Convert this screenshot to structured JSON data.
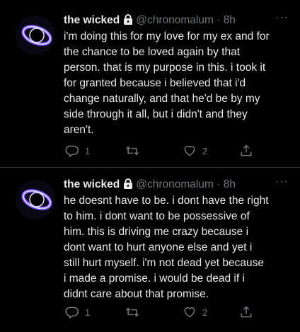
{
  "tweets": [
    {
      "display_name": "the wicked",
      "handle": "@chronomalum",
      "separator": "·",
      "time": "8h",
      "more": "···",
      "text": "i'm doing this for my love for my ex and for\nthe chance to be loved again by that\nperson. that is my purpose in this. i took it\nfor granted because i believed that i'd\nchange naturally, and that he'd be by my\nside through it all, but i didn't and they\naren't.",
      "reply_count": "1",
      "retweet_count": "",
      "like_count": "2",
      "locked": true
    },
    {
      "display_name": "the wicked",
      "handle": "@chronomalum",
      "separator": "·",
      "time": "8h",
      "more": "···",
      "text": "he doesnt have to be. i dont have the right\nto him. i dont want to be possessive of\nhim. this is driving me crazy because i\ndont want to hurt anyone else and yet i\nstill hurt myself. i'm not dead yet because\ni made a promise. i would be dead if i\ndidnt care about that promise.",
      "reply_count": "1",
      "retweet_count": "",
      "like_count": "2",
      "locked": true
    }
  ],
  "colors": {
    "background": "#000000",
    "text": "#e7e9ea",
    "secondary": "#71767b",
    "divider": "#2f3336"
  },
  "icons": [
    "lock-icon",
    "more-icon",
    "reply-icon",
    "retweet-icon",
    "like-icon",
    "share-icon"
  ]
}
